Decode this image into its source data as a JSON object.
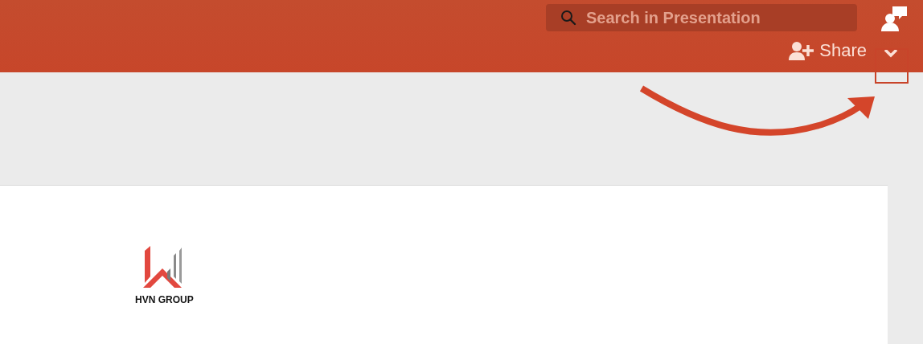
{
  "toolbar": {
    "search": {
      "placeholder": "Search in Presentation"
    },
    "share_button": {
      "label": "Share"
    }
  },
  "slide": {
    "logo_text": "HVN GROUP"
  }
}
